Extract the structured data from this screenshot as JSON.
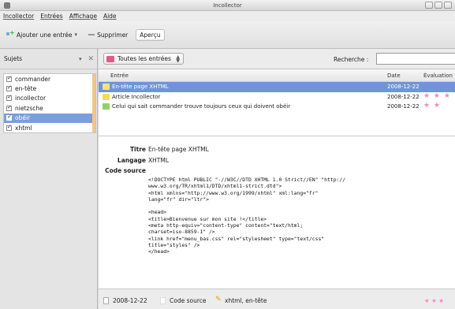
{
  "window": {
    "title": "Incollector"
  },
  "menu": [
    "Incollector",
    "Entrées",
    "Affichage",
    "Aide"
  ],
  "toolbar": {
    "add_label": "Ajouter une entrée",
    "delete_label": "Supprimer",
    "preview_label": "Aperçu"
  },
  "subjects": {
    "header": "Sujets",
    "items": [
      {
        "label": "commander",
        "checked": true,
        "selected": false
      },
      {
        "label": "en-tête",
        "checked": true,
        "selected": false
      },
      {
        "label": "incollector",
        "checked": true,
        "selected": false
      },
      {
        "label": "nietzsche",
        "checked": true,
        "selected": false
      },
      {
        "label": "obéir",
        "checked": true,
        "selected": true
      },
      {
        "label": "xhtml",
        "checked": true,
        "selected": false
      }
    ]
  },
  "filter": {
    "selected": "Toutes les entrées",
    "search_label": "Recherche :",
    "search_value": ""
  },
  "entries": {
    "columns": [
      "Entrée",
      "Date",
      "Évaluation"
    ],
    "rows": [
      {
        "title": "En-tête page XHTML",
        "date": "2008-12-22",
        "rating": 0,
        "selected": true,
        "icon_color": "#f7e27a"
      },
      {
        "title": "Article Incollector",
        "date": "2008-12-22",
        "rating": 3,
        "selected": false,
        "icon_color": "#f4dc52"
      },
      {
        "title": "Celui qui sait commander trouve toujours ceux qui doivent obéir",
        "date": "2008-12-22",
        "rating": 2,
        "selected": false,
        "icon_color": "#8dd36b"
      }
    ]
  },
  "detail": {
    "title_label": "Titre",
    "title_value": "En-tête page XHTML",
    "lang_label": "Langage",
    "lang_value": "XHTML",
    "code_label": "Code source",
    "code": "<!DOCTYPE html PUBLIC \"-//W3C//DTD XHTML 1.0 Strict//EN\" \"http://\nwww.w3.org/TR/xhtml1/DTD/xhtml1-strict.dtd\">\n<html xmlns=\"http://www.w3.org/1999/xhtml\" xml:lang=\"fr\"\nlang=\"fr\" dir=\"ltr\">\n\n<head>\n<title>Bienvenue sur mon site !</title>\n<meta http-equiv=\"content-type\" content=\"text/html;\ncharset=iso-8859-1\" />\n<link href=\"menu_bas.css\" rel=\"stylesheet\" type=\"text/css\"\ntitle=\"styles\" />\n</head>"
  },
  "status": {
    "date": "2008-12-22",
    "type": "Code source",
    "tags": "xhtml, en-tête",
    "rating_stars": "★ ★ ★"
  },
  "colors": {
    "selection": "#6f95d8",
    "star": "#f48bb8",
    "subject_tag": "#f2c48e"
  }
}
